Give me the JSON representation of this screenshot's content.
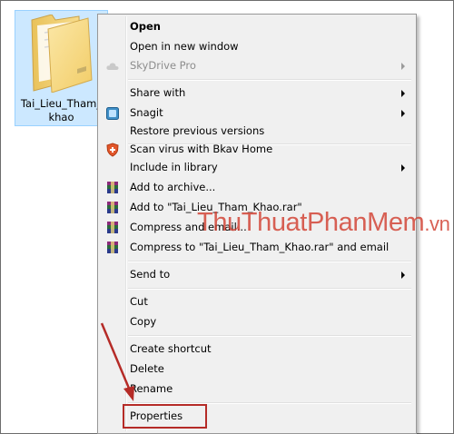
{
  "folder": {
    "label": "Tai_Lieu_Tham_Khao",
    "label_line1": "Tai_Lieu_Tham_",
    "label_line2": "khao"
  },
  "menu": {
    "items": [
      {
        "label": "Open",
        "bold": true
      },
      {
        "label": "Open in new window"
      },
      {
        "label": "SkyDrive Pro",
        "disabled": true,
        "submenu": true,
        "icon": "cloud-icon"
      },
      {
        "label": "Share with",
        "submenu": true
      },
      {
        "label": "Snagit",
        "submenu": true,
        "icon": "snagit-icon"
      },
      {
        "label": "Restore previous versions"
      },
      {
        "label": "Scan virus with Bkav Home",
        "icon": "bkav-shield-icon"
      },
      {
        "label": "Include in library",
        "submenu": true
      },
      {
        "label": "Add to archive...",
        "icon": "winrar-icon"
      },
      {
        "label": "Add to \"Tai_Lieu_Tham_Khao.rar\"",
        "icon": "winrar-icon"
      },
      {
        "label": "Compress and email...",
        "icon": "winrar-icon"
      },
      {
        "label": "Compress to \"Tai_Lieu_Tham_Khao.rar\" and email",
        "icon": "winrar-icon"
      },
      {
        "label": "Send to",
        "submenu": true
      },
      {
        "label": "Cut"
      },
      {
        "label": "Copy"
      },
      {
        "label": "Create shortcut"
      },
      {
        "label": "Delete"
      },
      {
        "label": "Rename"
      },
      {
        "label": "Properties"
      }
    ]
  },
  "watermark": {
    "part1": "ThuThuat",
    "part2": "PhanMem",
    "part3": ".vn"
  },
  "colors": {
    "selection_bg": "#cce8ff",
    "menu_bg": "#f0f0f0",
    "annotation_red": "#b52b27"
  }
}
